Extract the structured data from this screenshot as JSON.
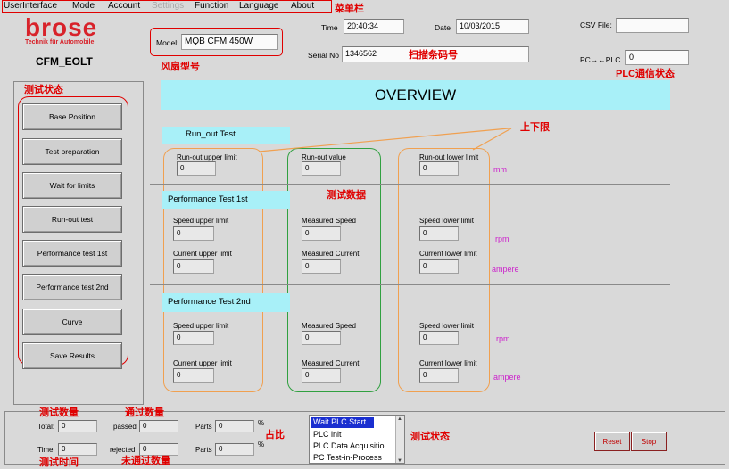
{
  "menu": {
    "items": [
      "UserInterface",
      "Mode",
      "Account",
      "Settings",
      "Function",
      "Language",
      "About"
    ]
  },
  "annotations": {
    "menubar": "菜单栏",
    "fan_model": "风扇型号",
    "barcode": "扫描条码号",
    "plc_status": "PLC通信状态",
    "test_status": "测试状态",
    "limits": "上下限",
    "test_data": "测试数据",
    "test_count": "测试数量",
    "pass_count": "通过数量",
    "ratio": "占比",
    "test_time": "测试时间",
    "fail_count": "未通过数量",
    "test_status_list": "测试状态"
  },
  "brand": {
    "name": "brose",
    "tagline": "Technik für Automobile",
    "app_name": "CFM_EOLT"
  },
  "header": {
    "model_label": "Model:",
    "model_value": "MQB CFM 450W",
    "time_label": "Time",
    "time_value": "20:40:34",
    "date_label": "Date",
    "date_value": "10/03/2015",
    "serial_label": "Serial No",
    "serial_value": "1346562",
    "csv_label": "CSV File:",
    "csv_value": "",
    "plc_label": "PC→←PLC",
    "plc_value": "0"
  },
  "sidebar": {
    "buttons": [
      "Base Position",
      "Test preparation",
      "Wait for limits",
      "Run-out test",
      "Performance test  1st",
      "Performance test  2nd",
      "Curve",
      "Save Results"
    ]
  },
  "overview": {
    "title": "OVERVIEW"
  },
  "runout": {
    "title": "Run_out Test",
    "upper_label": "Run-out upper limit",
    "upper_value": "0",
    "value_label": "Run-out value",
    "value_value": "0",
    "lower_label": "Run-out lower limit",
    "lower_value": "0",
    "unit": "mm"
  },
  "perf1": {
    "title": "Performance Test 1st",
    "speed_upper_label": "Speed upper limit",
    "speed_upper_value": "0",
    "measured_speed_label": "Measured Speed",
    "measured_speed_value": "0",
    "speed_lower_label": "Speed lower limit",
    "speed_lower_value": "0",
    "speed_unit": "rpm",
    "current_upper_label": "Current upper limit",
    "current_upper_value": "0",
    "measured_current_label": "Measured Current",
    "measured_current_value": "0",
    "current_lower_label": "Current lower limit",
    "current_lower_value": "0",
    "current_unit": "ampere"
  },
  "perf2": {
    "title": "Performance Test 2nd",
    "speed_upper_label": "Speed upper limit",
    "speed_upper_value": "0",
    "measured_speed_label": "Measured Speed",
    "measured_speed_value": "0",
    "speed_lower_label": "Speed lower limit",
    "speed_lower_value": "0",
    "speed_unit": "rpm",
    "current_upper_label": "Current upper limit",
    "current_upper_value": "0",
    "measured_current_label": "Measured Current",
    "measured_current_value": "0",
    "current_lower_label": "Current lower limit",
    "current_lower_value": "0",
    "current_unit": "ampere"
  },
  "stats": {
    "total_label": "Total:",
    "total_value": "0",
    "passed_label": "passed",
    "passed_value": "0",
    "parts1_label": "Parts",
    "parts1_value": "0",
    "pct1": "%",
    "time_label": "Time:",
    "time_value": "0",
    "rejected_label": "rejected",
    "rejected_value": "0",
    "parts2_label": "Parts",
    "parts2_value": "0",
    "pct2": "%"
  },
  "status_list": {
    "items": [
      "Wait PLC Start",
      "PLC init",
      "PLC Data Acquisitio",
      "PC Test-in-Process"
    ]
  },
  "controls": {
    "reset": "Reset",
    "stop": "Stop"
  },
  "colors": {
    "accent_red": "#e00000",
    "cyan": "#a8f0f8",
    "orange": "#f0a050",
    "green": "#30a040",
    "magenta": "#cc22cc"
  }
}
